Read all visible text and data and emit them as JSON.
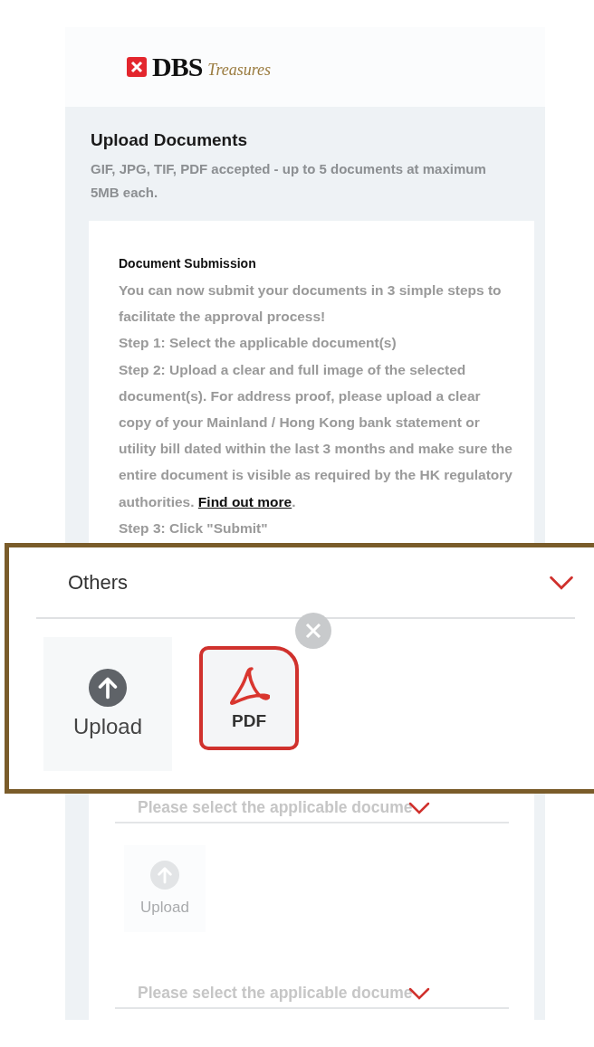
{
  "logo": {
    "brand": "DBS",
    "tagline": "Treasures"
  },
  "section": {
    "title": "Upload Documents",
    "subtitle": "GIF, JPG, TIF, PDF accepted - up to 5 documents at maximum 5MB each."
  },
  "info_card": {
    "heading": "Document Submission",
    "paragraphs": [
      {
        "text": "You can now submit your documents in 3 simple steps to facilitate the approval process!"
      },
      {
        "text": "Step 1: Select the applicable document(s)"
      },
      {
        "text": "Step 2: Upload a clear and full image of the selected document(s). For address proof, please upload a clear copy of your Mainland / Hong Kong bank statement or utility bill dated within the last 3 months and make sure the entire document is visible as required by the HK regulatory authorities.",
        "link": "Find out more",
        "after": "."
      },
      {
        "text": "Step 3: Click \"Submit\""
      }
    ]
  },
  "callout": {
    "dropdown": {
      "value": "Others"
    },
    "tiles": [
      {
        "kind": "upload",
        "label": "Upload"
      },
      {
        "kind": "file",
        "label": "PDF",
        "removable": true
      }
    ]
  },
  "lower_fields": [
    {
      "kind": "select",
      "placeholder": "Please select the applicable docume"
    },
    {
      "kind": "upload",
      "label": "Upload",
      "disabled": true
    },
    {
      "kind": "select",
      "placeholder": "Please select the applicable docume"
    }
  ]
}
